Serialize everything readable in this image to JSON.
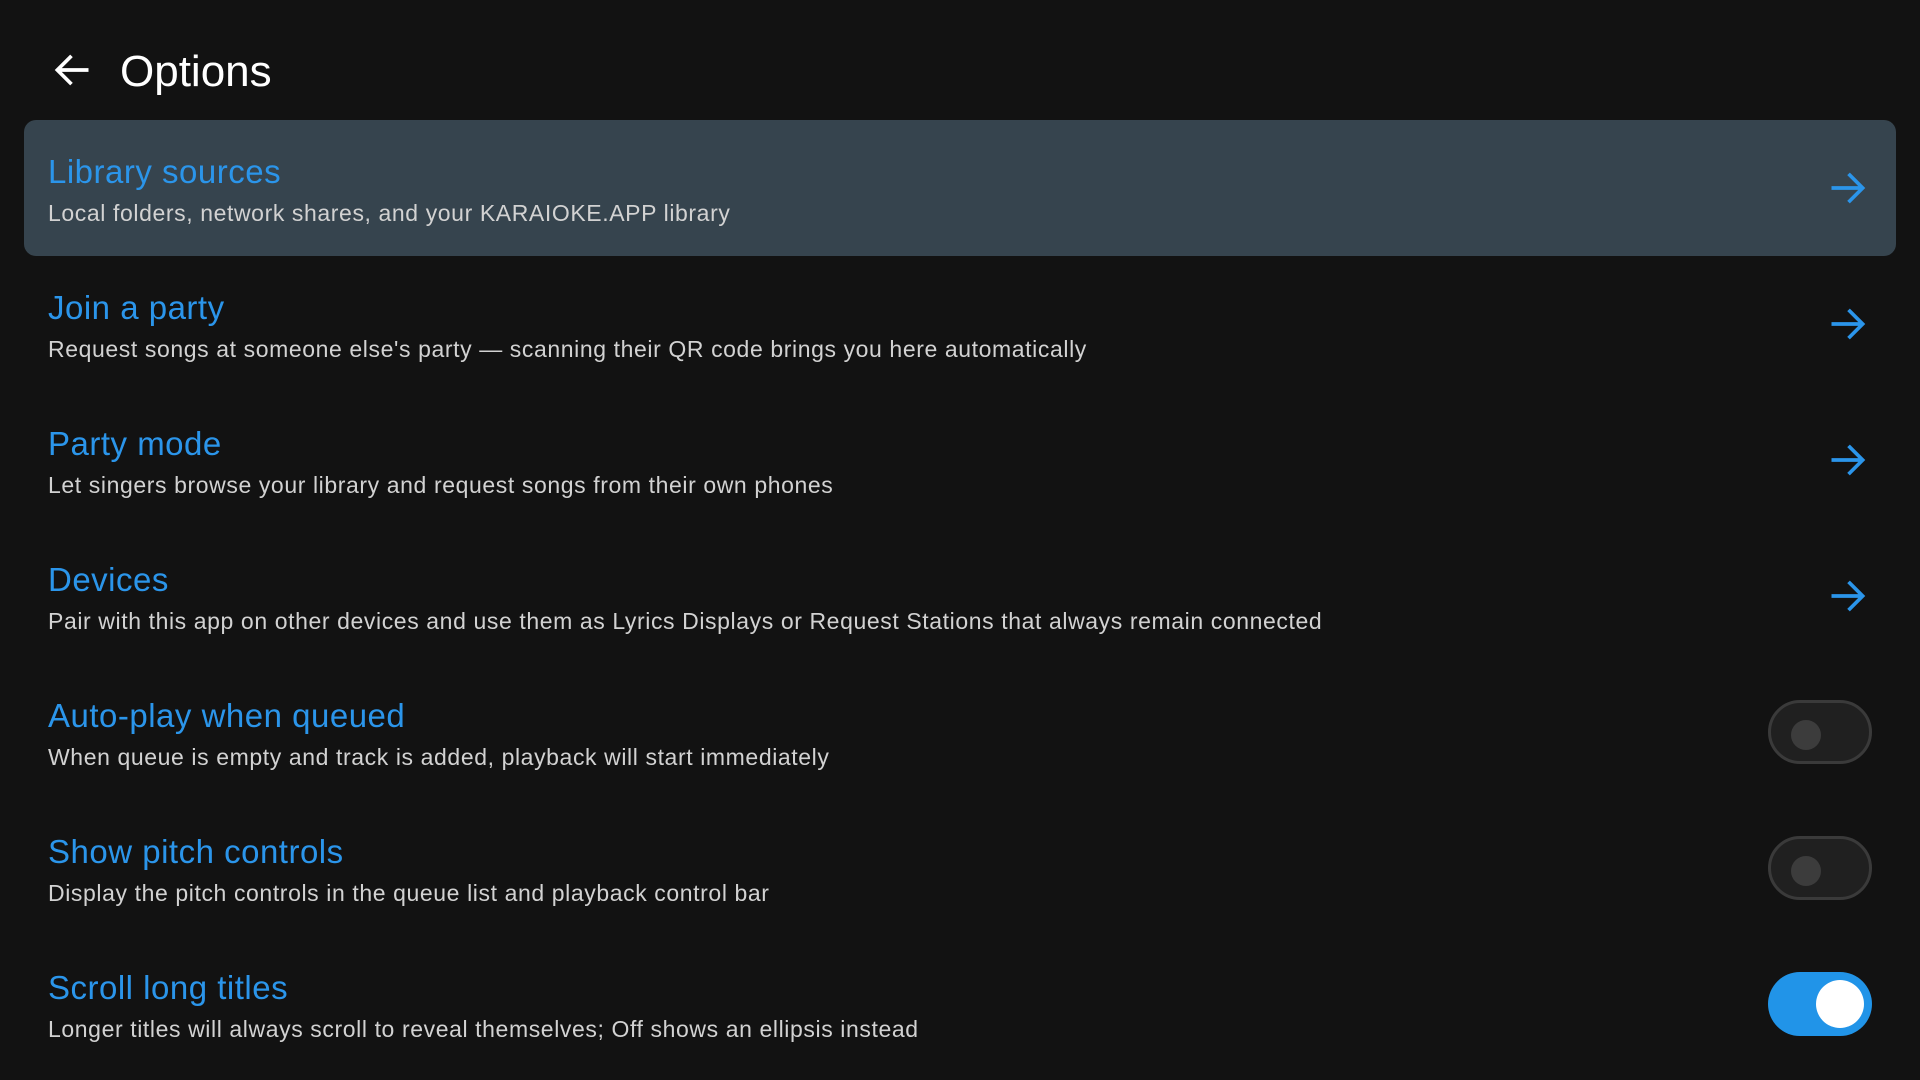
{
  "header": {
    "title": "Options"
  },
  "colors": {
    "accent": "#2b95ea",
    "background": "#121212",
    "selected_row": "#36444e",
    "toggle_on": "#2194e8"
  },
  "items": [
    {
      "title": "Library sources",
      "subtitle": "Local folders, network shares, and your KARAIOKE.APP library",
      "control": "arrow-right-icon",
      "selected": true
    },
    {
      "title": "Join a party",
      "subtitle": "Request songs at someone else's party — scanning their QR code brings you here automatically",
      "control": "arrow-right-icon"
    },
    {
      "title": "Party mode",
      "subtitle": "Let singers browse your library and request songs from their own phones",
      "control": "arrow-right-icon"
    },
    {
      "title": "Devices",
      "subtitle": "Pair with this app on other devices and use them as Lyrics Displays or Request Stations that always remain connected",
      "control": "arrow-right-icon"
    },
    {
      "title": "Auto-play when queued",
      "subtitle": "When queue is empty and track is added, playback will start immediately",
      "control": "toggle",
      "checked": false
    },
    {
      "title": "Show pitch controls",
      "subtitle": "Display the pitch controls in the queue list and playback control bar",
      "control": "toggle",
      "checked": false
    },
    {
      "title": "Scroll long titles",
      "subtitle": "Longer titles will always scroll to reveal themselves; Off shows an ellipsis instead",
      "control": "toggle",
      "checked": true
    }
  ]
}
